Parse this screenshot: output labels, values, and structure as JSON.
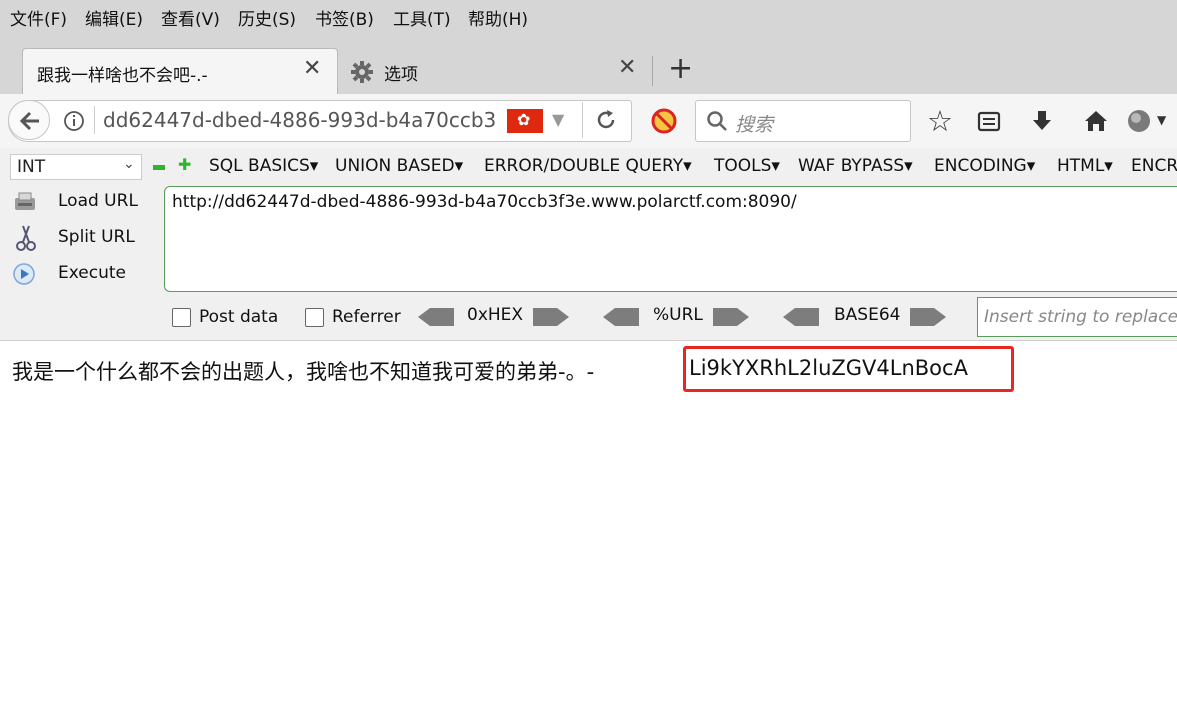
{
  "menu": [
    "文件(F)",
    "编辑(E)",
    "查看(V)",
    "历史(S)",
    "书签(B)",
    "工具(T)",
    "帮助(H)"
  ],
  "tabs": [
    {
      "title": "跟我一样啥也不会吧-.-",
      "active": true
    },
    {
      "title": "选项",
      "active": false
    }
  ],
  "navbar": {
    "url": "dd62447d-dbed-4886-993d-b4a70ccb3",
    "search_placeholder": "搜索"
  },
  "hackbar": {
    "select_value": "INT",
    "menus": [
      "SQL BASICS▾",
      "UNION BASED▾",
      "ERROR/DOUBLE QUERY▾",
      "TOOLS▾",
      "WAF BYPASS▾",
      "ENCODING▾",
      "HTML▾",
      "ENCR"
    ],
    "load_url": "Load URL",
    "split_url": "Split URL",
    "execute": "Execute",
    "url_value": "http://dd62447d-dbed-4886-993d-b4a70ccb3f3e.www.polarctf.com:8090/",
    "post_data": "Post data",
    "referrer": "Referrer",
    "enc_hex": "0xHEX",
    "enc_url": "%URL",
    "enc_base64": "BASE64",
    "replace_placeholder": "Insert string to replace"
  },
  "page": {
    "text": "我是一个什么都不会的出题人，我啥也不知道我可爱的弟弟-。-",
    "answer": "Li9kYXRhL2luZGV4LnBocA"
  },
  "colors": {
    "highlight": "#e8271f",
    "hackbar_border": "#5b9b5b"
  }
}
